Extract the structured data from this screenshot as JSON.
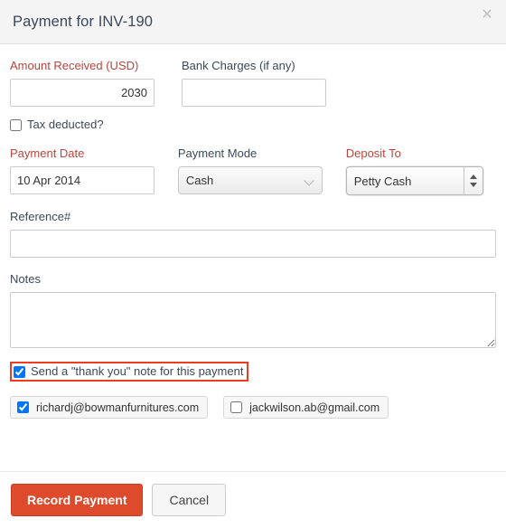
{
  "dialog": {
    "title": "Payment for INV-190",
    "close_icon": "close-icon"
  },
  "form": {
    "amount": {
      "label": "Amount Received (USD)",
      "value": "2030",
      "placeholder": "",
      "required": true
    },
    "bank_charges": {
      "label": "Bank Charges (if any)",
      "value": "",
      "placeholder": "",
      "required": false
    },
    "tax_deducted": {
      "label": "Tax deducted?",
      "checked": false
    },
    "payment_date": {
      "label": "Payment Date",
      "value": "10 Apr 2014",
      "placeholder": "",
      "required": true
    },
    "payment_mode": {
      "label": "Payment Mode",
      "selected": "Cash",
      "options": [
        "Cash"
      ],
      "icon": "chevron-down-icon"
    },
    "deposit_to": {
      "label": "Deposit To",
      "selected": "Petty Cash",
      "options": [
        "Petty Cash"
      ],
      "icon": "stepper-arrows-icon",
      "required": true
    },
    "reference": {
      "label": "Reference#",
      "value": "",
      "placeholder": ""
    },
    "notes": {
      "label": "Notes",
      "value": "",
      "placeholder": ""
    },
    "thank_you": {
      "label": "Send a \"thank you\" note for this payment",
      "checked": true,
      "highlighted": true
    },
    "emails": [
      {
        "address": "richardj@bowmanfurnitures.com",
        "checked": true
      },
      {
        "address": "jackwilson.ab@gmail.com",
        "checked": false
      }
    ]
  },
  "footer": {
    "submit_label": "Record Payment",
    "cancel_label": "Cancel"
  },
  "colors": {
    "accent": "#de4b2c",
    "required_label": "#b8453a",
    "highlight_outline": "#ee3b24",
    "header_bg": "#f4f4f4"
  }
}
